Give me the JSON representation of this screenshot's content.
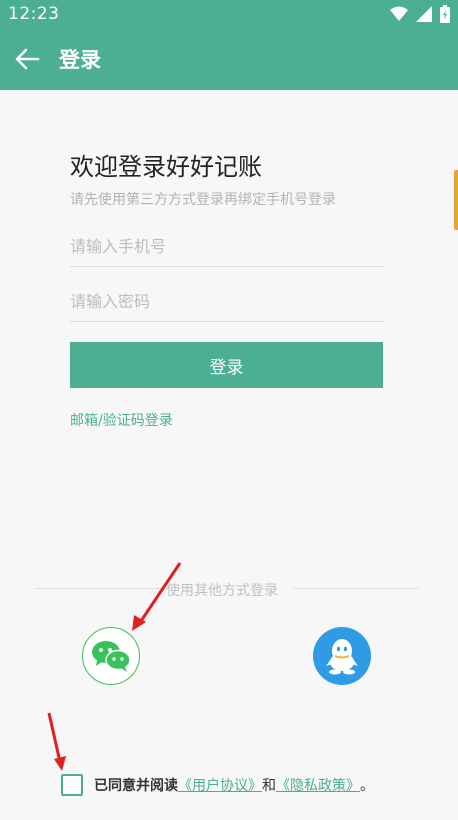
{
  "status_bar": {
    "time": "12:23",
    "icons": [
      "wifi-icon",
      "signal-icon",
      "battery-icon"
    ]
  },
  "app_bar": {
    "title": "登录",
    "back_icon": "arrow-left-icon"
  },
  "welcome": {
    "title": "欢迎登录好好记账",
    "subtitle": "请先使用第三方方式登录再绑定手机号登录"
  },
  "form": {
    "phone_placeholder": "请输入手机号",
    "phone_value": "",
    "password_placeholder": "请输入密码",
    "password_value": "",
    "login_label": "登录",
    "alt_login_label": "邮箱/验证码登录"
  },
  "other_login": {
    "label": "使用其他方式登录",
    "wechat_icon": "wechat-icon",
    "qq_icon": "qq-icon"
  },
  "agreement": {
    "prefix": "已同意并阅读",
    "user_agreement": "《用户协议》",
    "and": "和",
    "privacy_policy": "《隐私政策》",
    "suffix": "。",
    "checked": false
  },
  "colors": {
    "primary": "#4caf93",
    "wechat": "#38c25a",
    "qq": "#2e9be4",
    "annotation": "#e02020"
  }
}
